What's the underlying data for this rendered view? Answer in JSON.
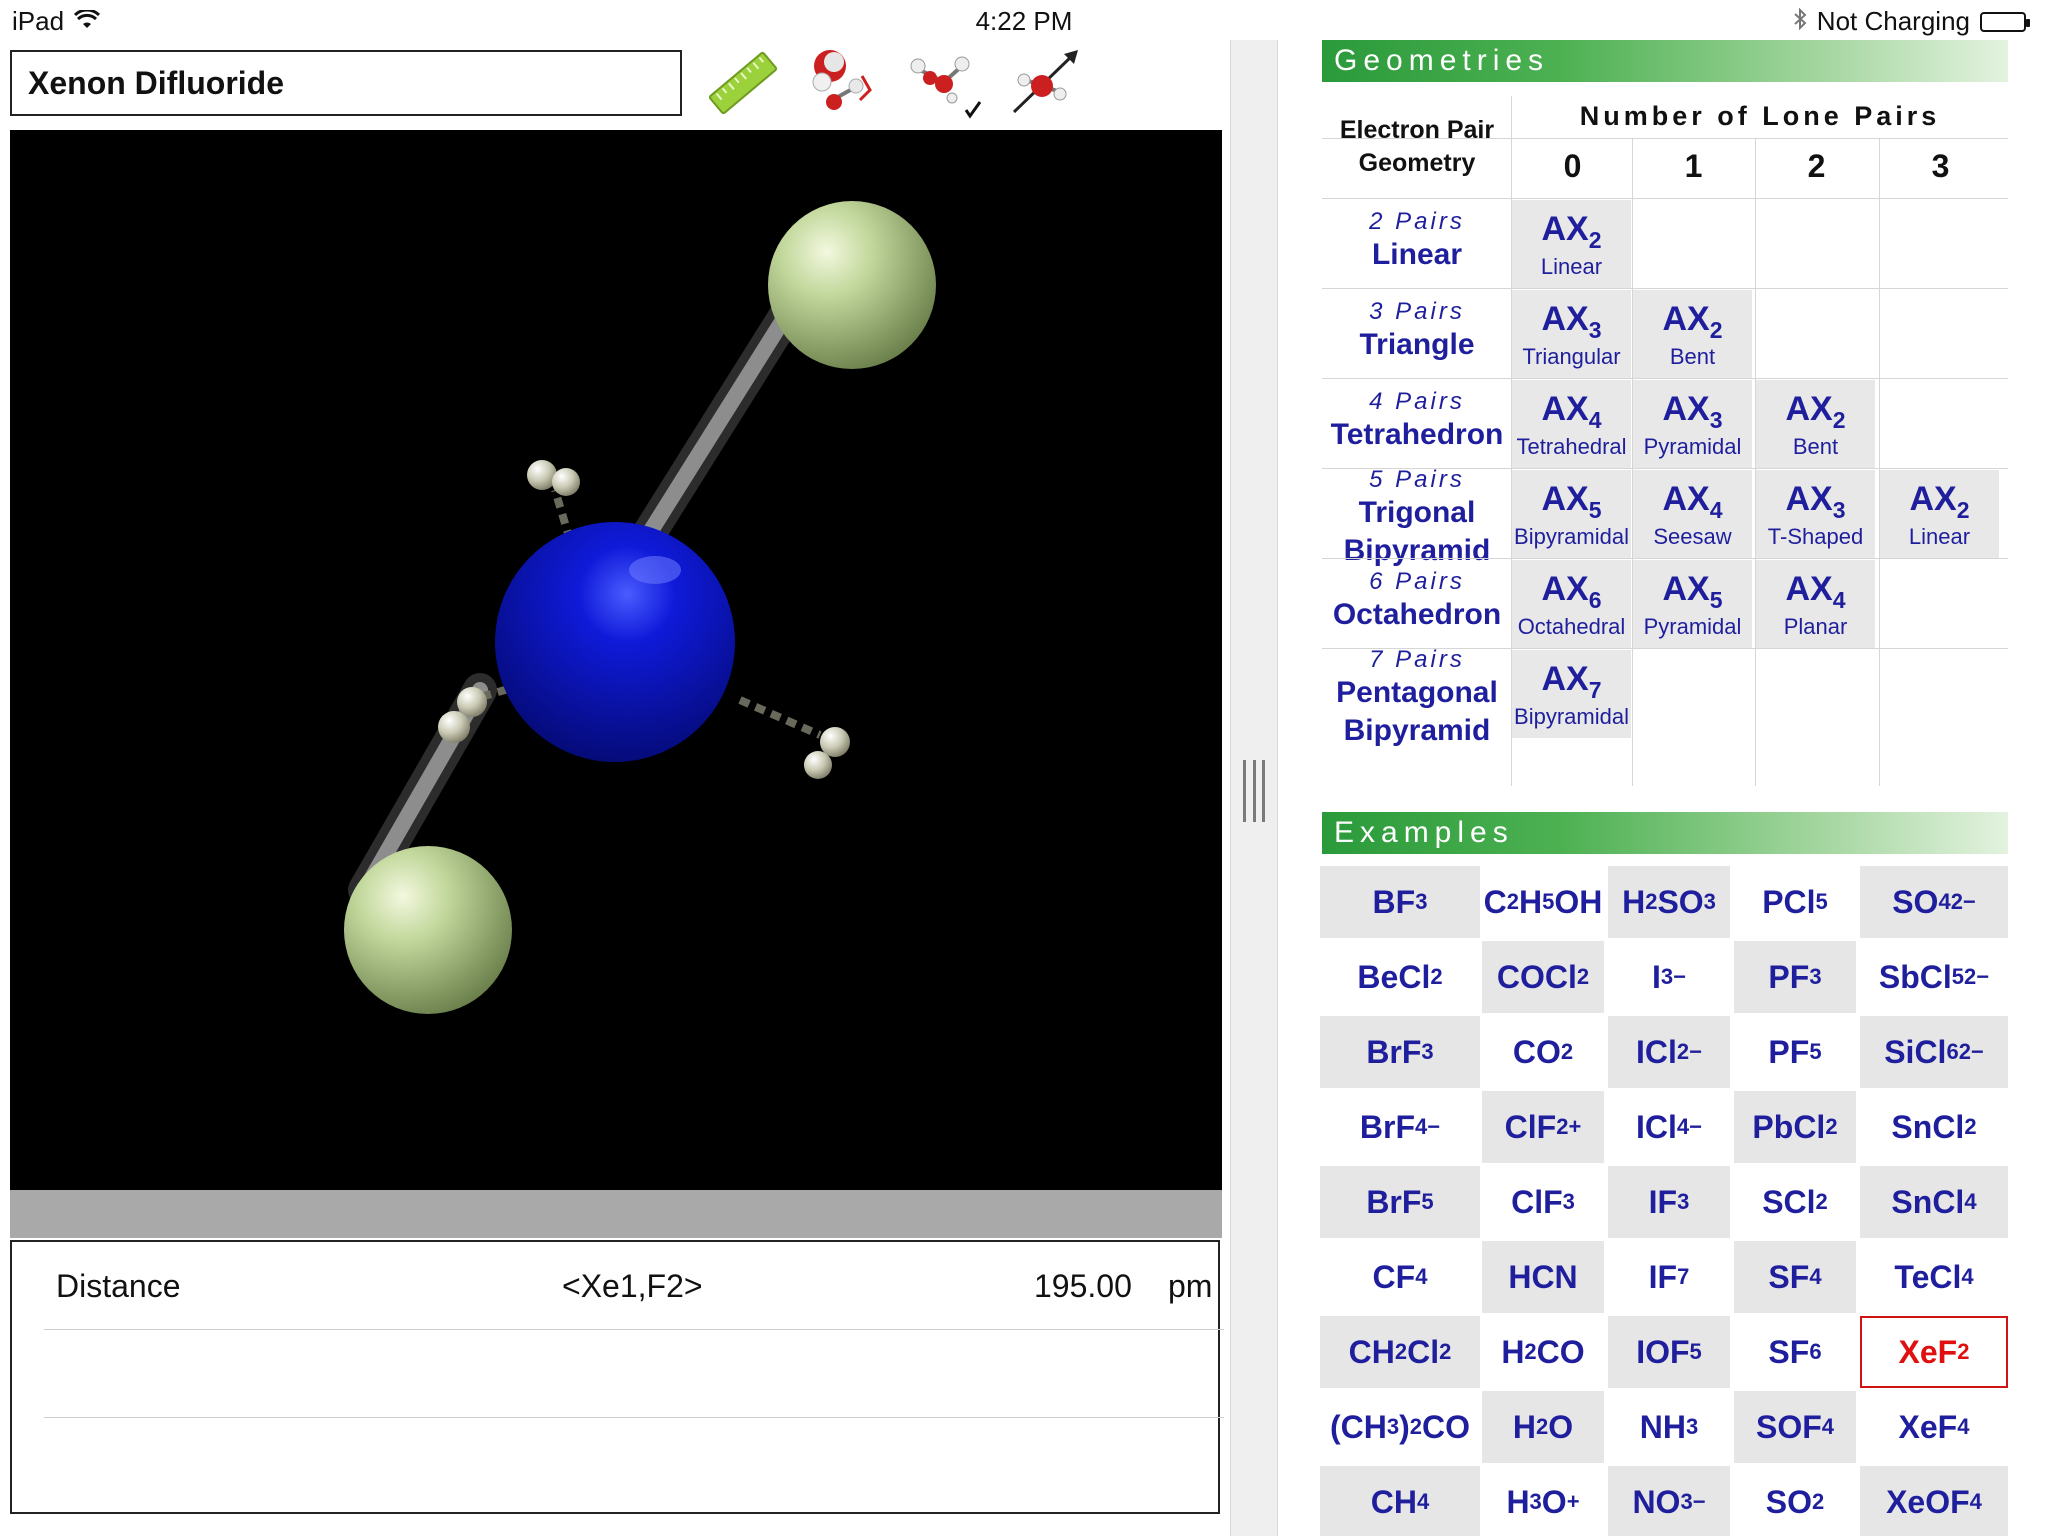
{
  "status_bar": {
    "device": "iPad",
    "time": "4:22 PM",
    "charging": "Not Charging"
  },
  "molecule": {
    "name": "Xenon Difluoride"
  },
  "toolbar": {
    "tools": [
      "ruler-tool",
      "model-style-tool",
      "lone-pairs-toggle",
      "dipole-tool"
    ]
  },
  "measurement": {
    "type": "Distance",
    "atoms": "<Xe1,F2>",
    "value": "195.00",
    "unit": "pm"
  },
  "geometries": {
    "title": "Geometries",
    "epg_header_line1": "Electron Pair",
    "epg_header_line2": "Geometry",
    "lone_pairs_header": "Number of Lone Pairs",
    "lone_pair_counts": [
      "0",
      "1",
      "2",
      "3"
    ],
    "rows": [
      {
        "pairs": "2 Pairs",
        "name1": "Linear",
        "name2": "",
        "cells": [
          {
            "base": "AX",
            "sub": "2",
            "shape": "Linear"
          },
          null,
          null,
          null
        ]
      },
      {
        "pairs": "3 Pairs",
        "name1": "Triangle",
        "name2": "",
        "cells": [
          {
            "base": "AX",
            "sub": "3",
            "shape": "Triangular"
          },
          {
            "base": "AX",
            "sub": "2",
            "shape": "Bent"
          },
          null,
          null
        ]
      },
      {
        "pairs": "4 Pairs",
        "name1": "Tetrahedron",
        "name2": "",
        "cells": [
          {
            "base": "AX",
            "sub": "4",
            "shape": "Tetrahedral"
          },
          {
            "base": "AX",
            "sub": "3",
            "shape": "Pyramidal"
          },
          {
            "base": "AX",
            "sub": "2",
            "shape": "Bent"
          },
          null
        ]
      },
      {
        "pairs": "5 Pairs",
        "name1": "Trigonal",
        "name2": "Bipyramid",
        "cells": [
          {
            "base": "AX",
            "sub": "5",
            "shape": "Bipyramidal"
          },
          {
            "base": "AX",
            "sub": "4",
            "shape": "Seesaw"
          },
          {
            "base": "AX",
            "sub": "3",
            "shape": "T-Shaped"
          },
          {
            "base": "AX",
            "sub": "2",
            "shape": "Linear"
          }
        ]
      },
      {
        "pairs": "6 Pairs",
        "name1": "Octahedron",
        "name2": "",
        "cells": [
          {
            "base": "AX",
            "sub": "6",
            "shape": "Octahedral"
          },
          {
            "base": "AX",
            "sub": "5",
            "shape": "Pyramidal"
          },
          {
            "base": "AX",
            "sub": "4",
            "shape": "Planar"
          },
          null
        ]
      },
      {
        "pairs": "7 Pairs",
        "name1": "Pentagonal",
        "name2": "Bipyramid",
        "cells": [
          {
            "base": "AX",
            "sub": "7",
            "shape": "Bipyramidal"
          },
          null,
          null,
          null
        ]
      }
    ]
  },
  "examples": {
    "title": "Examples",
    "selected": "XeF2",
    "columns": [
      [
        "BF<sub>3</sub>",
        "BeCl<sub>2</sub>",
        "BrF<sub>3</sub>",
        "BrF<sub>4</sub><sup>−</sup>",
        "BrF<sub>5</sub>",
        "CF<sub>4</sub>",
        "CH<sub>2</sub>Cl<sub>2</sub>",
        "(CH<sub>3</sub>)<sub>2</sub>CO",
        "CH<sub>4</sub>"
      ],
      [
        "C<sub>2</sub>H<sub>5</sub>OH",
        "COCl<sub>2</sub>",
        "CO<sub>2</sub>",
        "ClF<sub>2</sub><sup>+</sup>",
        "ClF<sub>3</sub>",
        "HCN",
        "H<sub>2</sub>CO",
        "H<sub>2</sub>O",
        "H<sub>3</sub>O<sup>+</sup>"
      ],
      [
        "H<sub>2</sub>SO<sub>3</sub>",
        "I<sub>3</sub><sup>−</sup>",
        "ICl<sub>2</sub><sup>−</sup>",
        "ICl<sub>4</sub><sup>−</sup>",
        "IF<sub>3</sub>",
        "IF<sub>7</sub>",
        "IOF<sub>5</sub>",
        "NH<sub>3</sub>",
        "NO<sub>3</sub><sup>−</sup>"
      ],
      [
        "PCl<sub>5</sub>",
        "PF<sub>3</sub>",
        "PF<sub>5</sub>",
        "PbCl<sub>2</sub>",
        "SCl<sub>2</sub>",
        "SF<sub>4</sub>",
        "SF<sub>6</sub>",
        "SOF<sub>4</sub>",
        "SO<sub>2</sub>"
      ],
      [
        "SO<sub>4</sub><sup>2−</sup>",
        "SbCl<sub>5</sub><sup>2−</sup>",
        "SiCl<sub>6</sub><sup>2−</sup>",
        "SnCl<sub>2</sub>",
        "SnCl<sub>4</sub>",
        "TeCl<sub>4</sub>",
        "XeF<sub>2</sub>",
        "XeF<sub>4</sub>",
        "XeOF<sub>4</sub>"
      ]
    ]
  },
  "colors": {
    "accent_blue": "#1f1f9e",
    "header_green": "#2a9a3a",
    "selected_red": "#e01010",
    "xe_atom": "#0a10c8",
    "f_atom": "#b5cf8c"
  }
}
